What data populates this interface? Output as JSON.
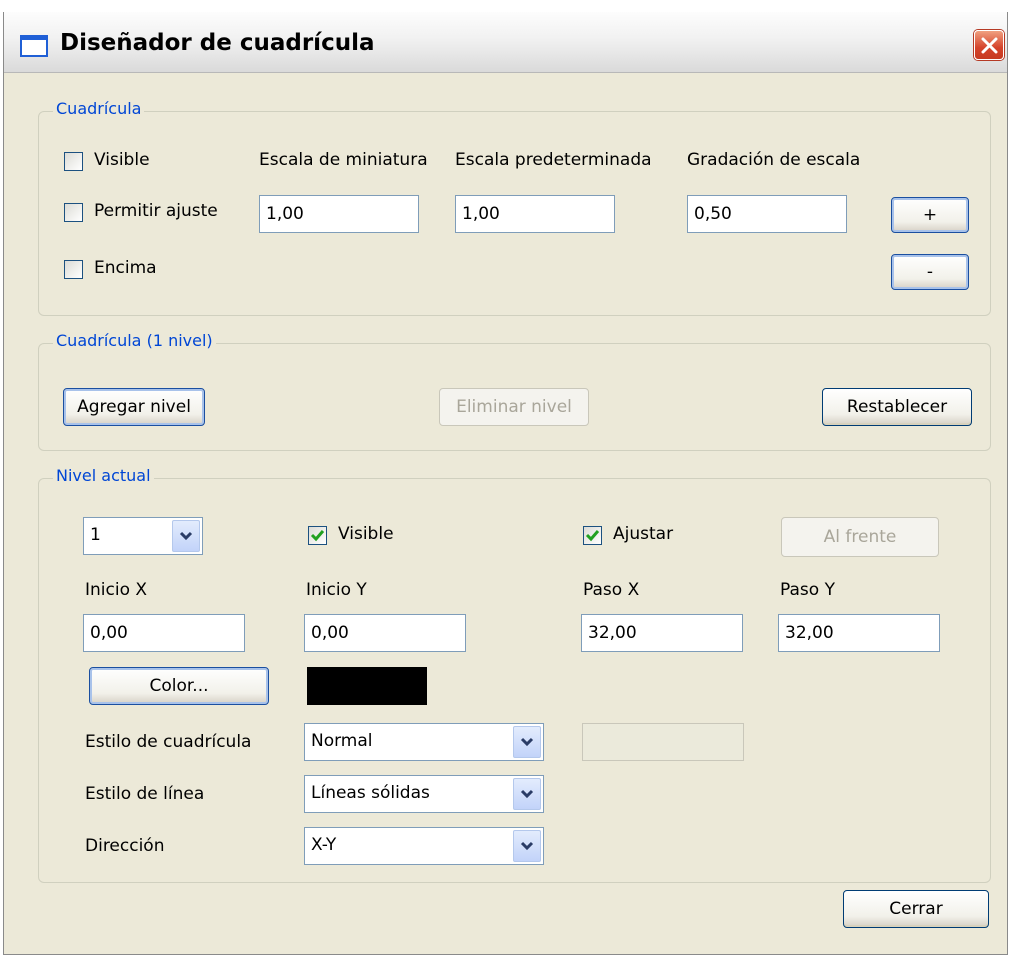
{
  "window": {
    "title": "Diseñador de cuadrícula"
  },
  "grid": {
    "legend": "Cuadrícula",
    "visible_label": "Visible",
    "visible_checked": false,
    "snap_label": "Permitir ajuste",
    "snap_checked": false,
    "ontop_label": "Encima",
    "ontop_checked": false,
    "thumb_scale_label": "Escala de miniatura",
    "thumb_scale_value": "1,00",
    "default_scale_label": "Escala predeterminada",
    "default_scale_value": "1,00",
    "scale_step_label": "Gradación de escala",
    "scale_step_value": "0,50",
    "plus_label": "+",
    "minus_label": "-"
  },
  "levels": {
    "legend": "Cuadrícula (1 nivel)",
    "add_label": "Agregar nivel",
    "remove_label": "Eliminar nivel",
    "reset_label": "Restablecer"
  },
  "current": {
    "legend": "Nivel actual",
    "level_value": "1",
    "visible_label": "Visible",
    "visible_checked": true,
    "adjust_label": "Ajustar",
    "adjust_checked": true,
    "front_label": "Al frente",
    "start_x_label": "Inicio X",
    "start_x_value": "0,00",
    "start_y_label": "Inicio Y",
    "start_y_value": "0,00",
    "step_x_label": "Paso X",
    "step_x_value": "32,00",
    "step_y_label": "Paso Y",
    "step_y_value": "32,00",
    "color_button_label": "Color...",
    "color_value": "#000000",
    "grid_style_label": "Estilo de cuadrícula",
    "grid_style_value": "Normal",
    "line_style_label": "Estilo de línea",
    "line_style_value": "Líneas sólidas",
    "direction_label": "Dirección",
    "direction_value": "X-Y"
  },
  "footer": {
    "close_label": "Cerrar"
  },
  "icons": {
    "title": "window-icon",
    "close": "close-x-icon",
    "check": "checkmark-icon",
    "dropdown": "chevron-down-icon"
  },
  "colors": {
    "legend_text": "#0046d5",
    "window_bg": "#ece9d8",
    "check_green": "#21a121",
    "close_red": "#d5432b"
  }
}
